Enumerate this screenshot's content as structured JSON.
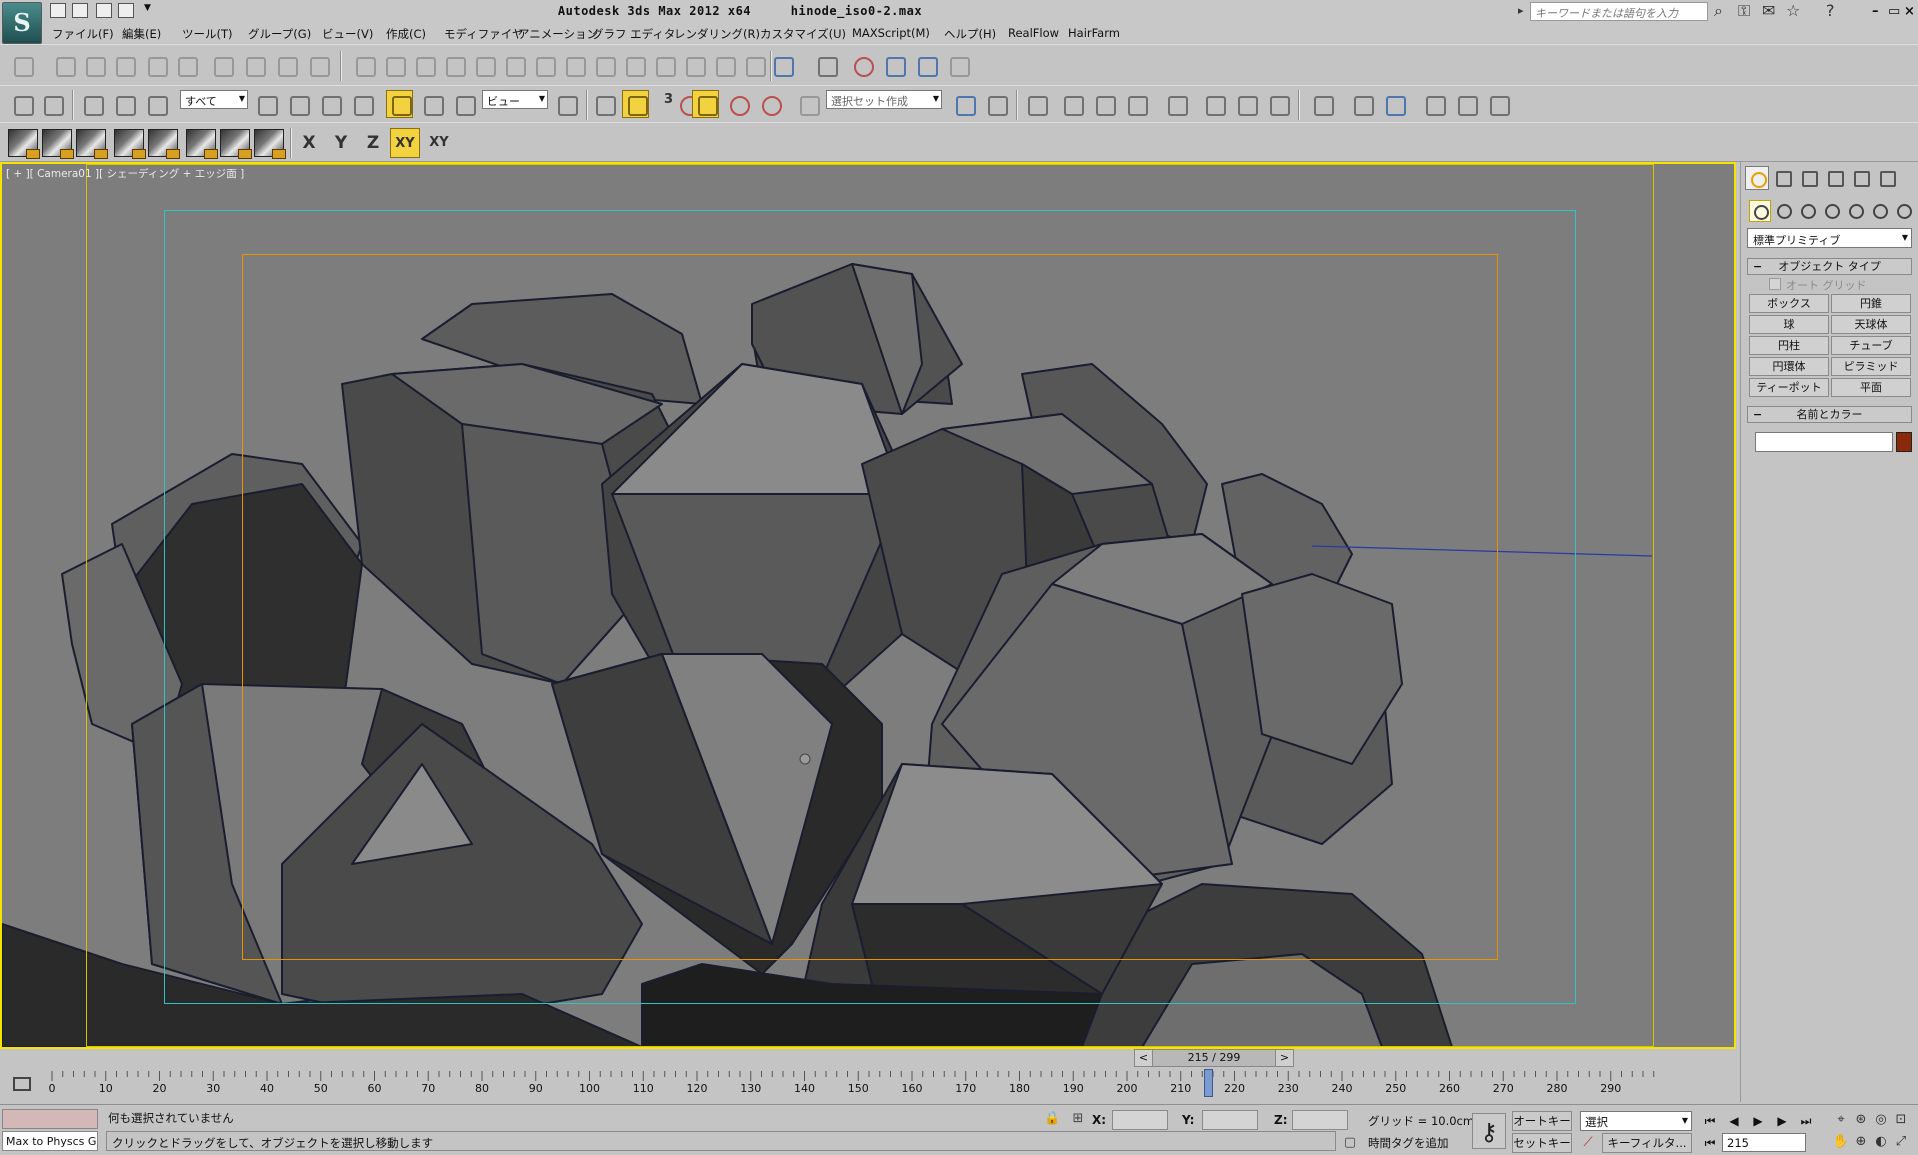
{
  "titlebar": {
    "logo": "S",
    "app_title": "Autodesk 3ds Max  2012 x64",
    "file_name": "hinode_iso0-2.max",
    "search_placeholder": "キーワードまたは語句を入力"
  },
  "menus": [
    "ファイル(F)",
    "編集(E)",
    "ツール(T)",
    "グループ(G)",
    "ビュー(V)",
    "作成(C)",
    "モディファイヤ",
    "アニメーション",
    "グラフ エディタ",
    "レンダリング(R)",
    "カスタマイズ(U)",
    "MAXScript(M)",
    "ヘルプ(H)",
    "RealFlow",
    "HairFarm"
  ],
  "toolbar2": {
    "filter_select": "すべて",
    "ref_coord": "ビュー",
    "snap_label": "3",
    "named_selection_placeholder": "選択セット作成"
  },
  "toolbar3": {
    "axis_buttons": [
      "X",
      "Y",
      "Z",
      "XY"
    ],
    "axis_active": "XY",
    "axis_extra": "XY"
  },
  "viewport": {
    "label": "[ + ][ Camera01 ][ シェーディング + エッジ面 ]",
    "colors": {
      "border_active": "#f4e400",
      "background": "#7d7d7d",
      "safe_frame_outer": "#d4c400",
      "safe_frame_action": "#2ec4c4",
      "safe_frame_title": "#e89400"
    }
  },
  "command_panel": {
    "category_dropdown": "標準プリミティブ",
    "object_type": {
      "title": "オブジェクト タイプ",
      "autogrid": "オート グリッド",
      "buttons": [
        "ボックス",
        "円錐",
        "球",
        "天球体",
        "円柱",
        "チューブ",
        "円環体",
        "ピラミッド",
        "ティーポット",
        "平面"
      ]
    },
    "name_color": {
      "title": "名前とカラー",
      "color": "#8a2a08"
    }
  },
  "timeslider": {
    "label": "215 / 299",
    "current": 215,
    "total": 299,
    "prev": "<",
    "next": ">"
  },
  "trackbar": {
    "ticks": [
      0,
      10,
      20,
      30,
      40,
      50,
      60,
      70,
      80,
      90,
      100,
      110,
      120,
      130,
      140,
      150,
      160,
      170,
      180,
      190,
      200,
      210,
      220,
      230,
      240,
      250,
      260,
      270,
      280,
      290
    ],
    "max_frame": 299,
    "current_frame": 215
  },
  "status": {
    "listener_text": "Max to Physcs G",
    "selection_status": "何も選択されていません",
    "prompt": "クリックとドラッグをして、オブジェクトを選択し移動します",
    "x_label": "X:",
    "y_label": "Y:",
    "z_label": "Z:",
    "grid": "グリッド = 10.0cm",
    "add_time_tag": "時間タグを追加",
    "auto_key": "オートキー",
    "set_key": "セットキー",
    "selection_set": "選択",
    "key_filters": "キーフィルタ...",
    "current_frame_field": "215"
  }
}
